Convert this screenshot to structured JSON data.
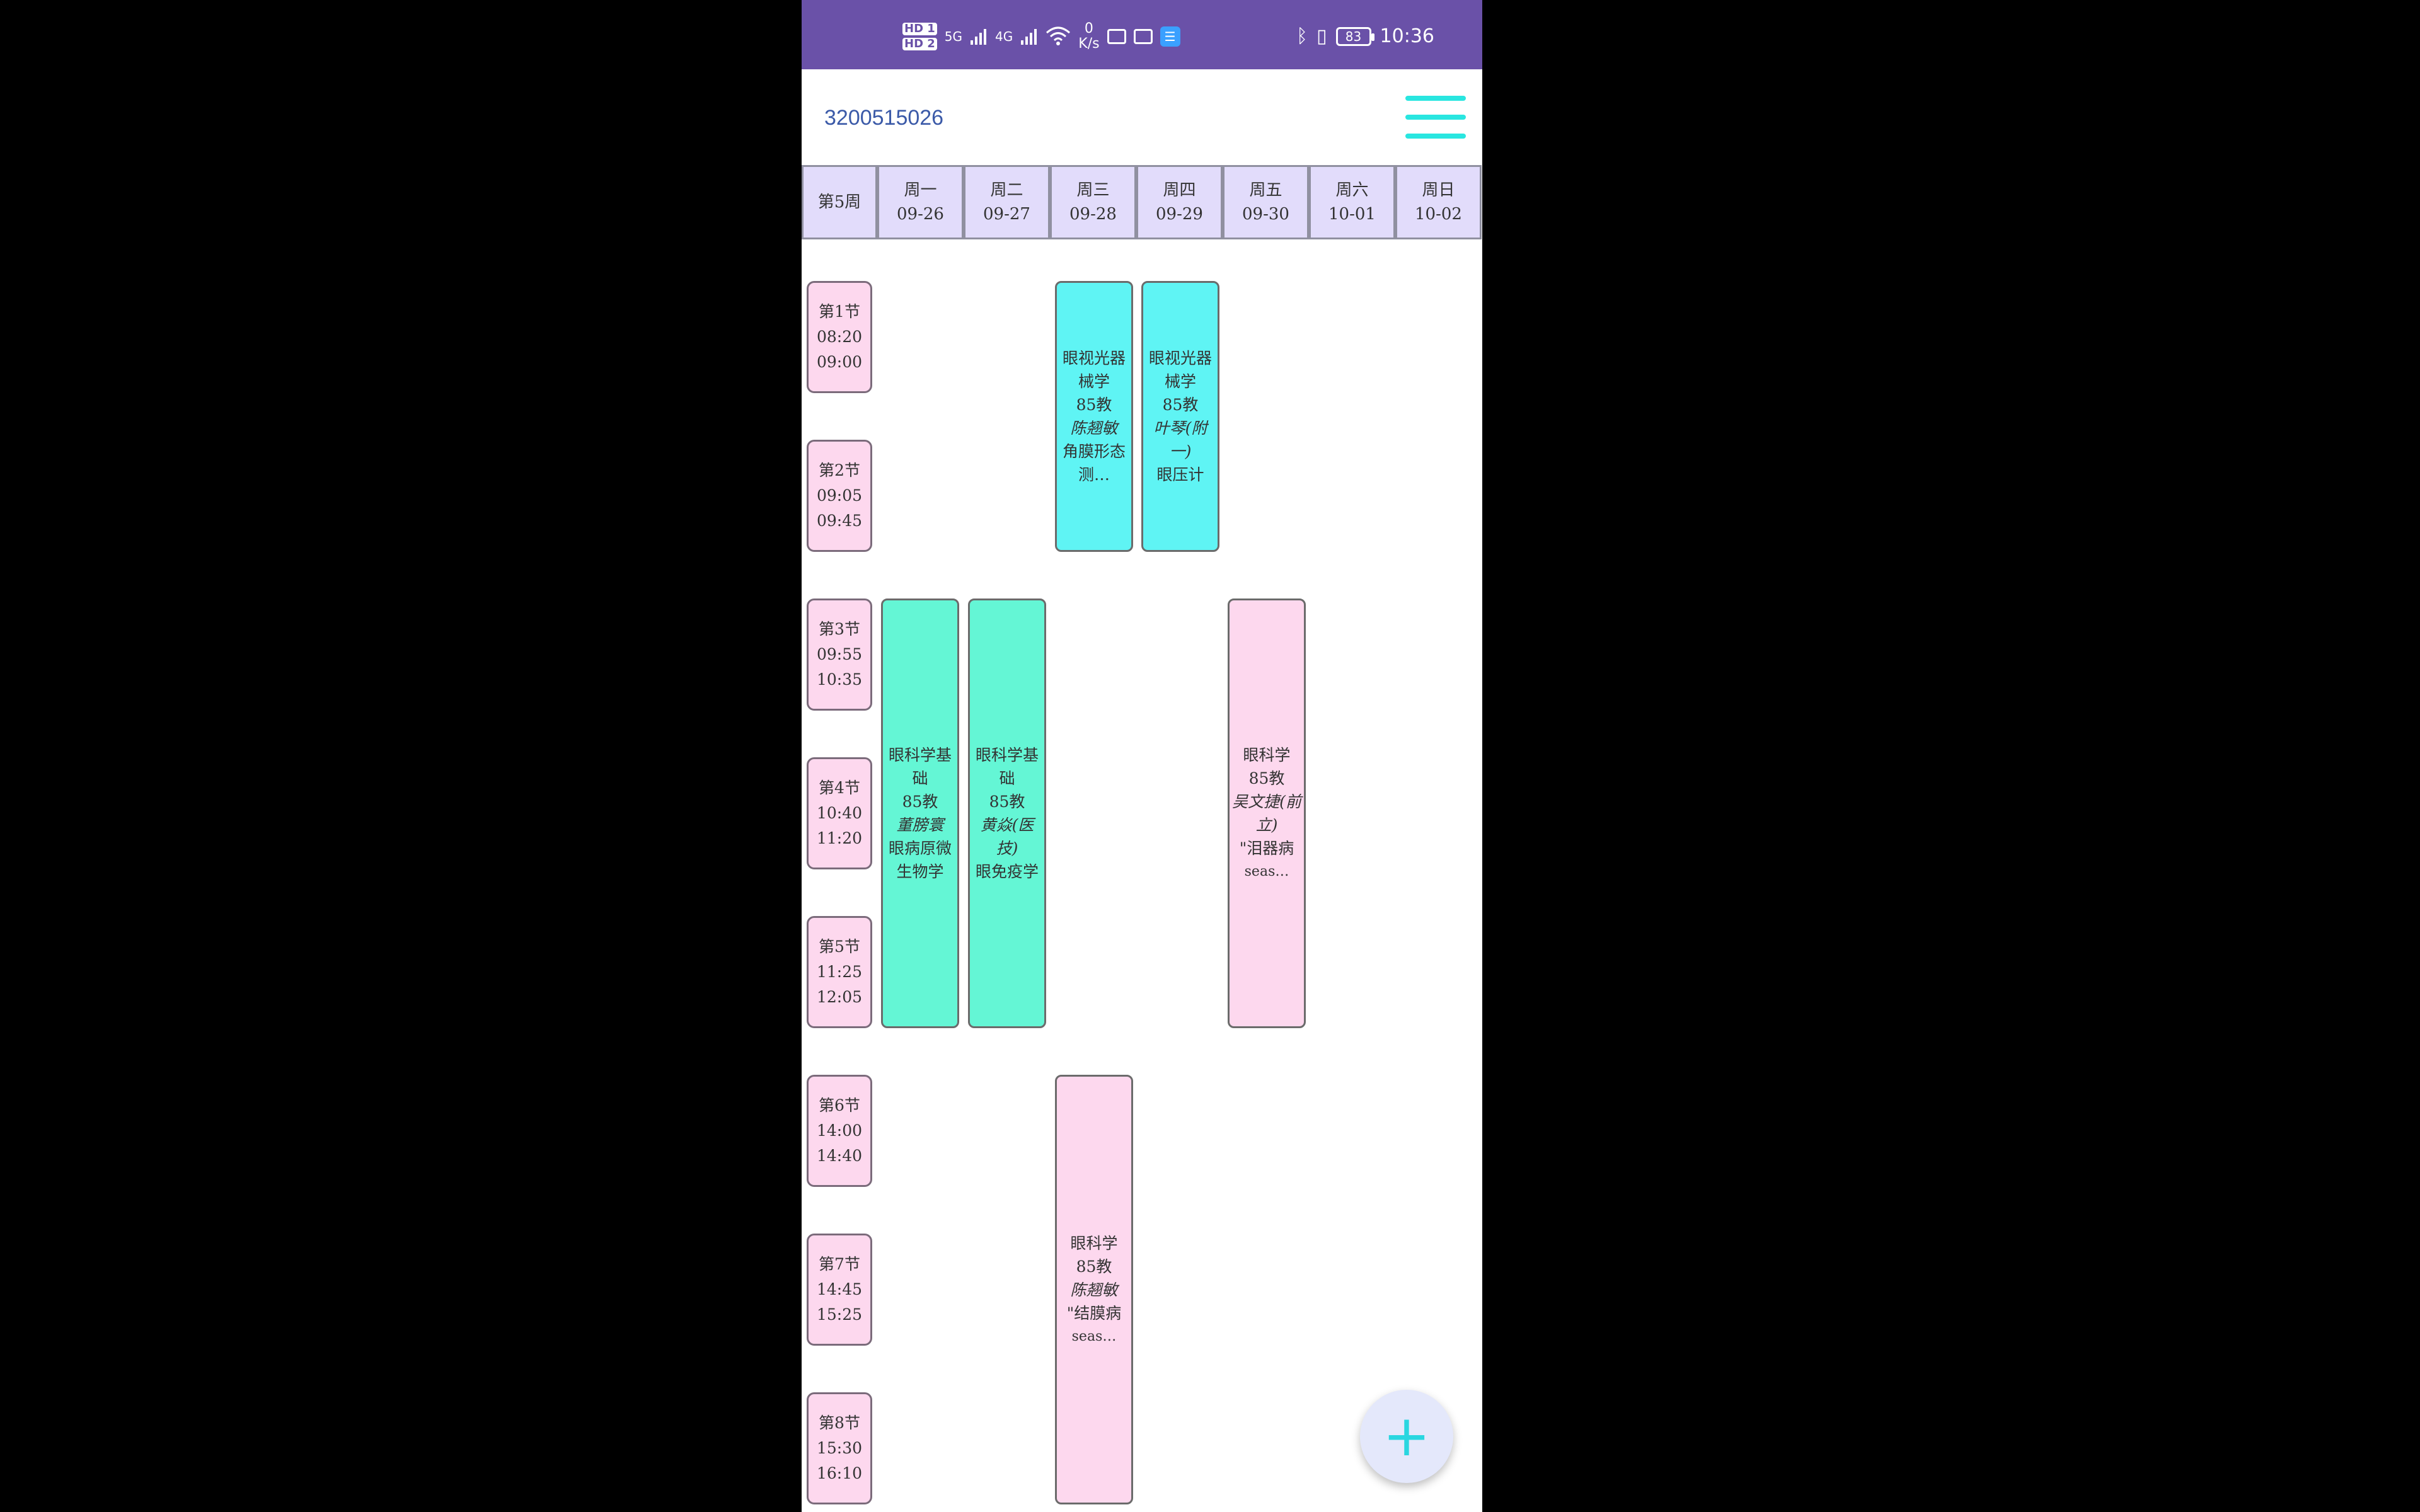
{
  "status_bar": {
    "hd1": "HD 1",
    "hd2": "HD 2",
    "sig1": "5G",
    "sig2": "4G",
    "net_speed": "0",
    "net_unit": "K/s",
    "battery": "83",
    "time": "10:36"
  },
  "header": {
    "student_id": "3200515026",
    "menu_icon": "hamburger-menu-icon"
  },
  "week_label": "第5周",
  "days": [
    {
      "name": "周一",
      "date": "09-26"
    },
    {
      "name": "周二",
      "date": "09-27"
    },
    {
      "name": "周三",
      "date": "09-28"
    },
    {
      "name": "周四",
      "date": "09-29"
    },
    {
      "name": "周五",
      "date": "09-30"
    },
    {
      "name": "周六",
      "date": "10-01"
    },
    {
      "name": "周日",
      "date": "10-02"
    }
  ],
  "periods": [
    {
      "label": "第1节",
      "start": "08:20",
      "end": "09:00"
    },
    {
      "label": "第2节",
      "start": "09:05",
      "end": "09:45"
    },
    {
      "label": "第3节",
      "start": "09:55",
      "end": "10:35"
    },
    {
      "label": "第4节",
      "start": "10:40",
      "end": "11:20"
    },
    {
      "label": "第5节",
      "start": "11:25",
      "end": "12:05"
    },
    {
      "label": "第6节",
      "start": "14:00",
      "end": "14:40"
    },
    {
      "label": "第7节",
      "start": "14:45",
      "end": "15:25"
    },
    {
      "label": "第8节",
      "start": "15:30",
      "end": "16:10"
    }
  ],
  "courses": [
    {
      "day": "周三",
      "periods": "1-2",
      "name": "眼视光器械学",
      "room": "85教",
      "teacher": "陈翘敏",
      "note": "角膜形态测…",
      "color": "#5ff4f4"
    },
    {
      "day": "周四",
      "periods": "1-2",
      "name": "眼视光器械学",
      "room": "85教",
      "teacher": "叶琴(附一)",
      "note": "眼压计",
      "color": "#5ff4f4"
    },
    {
      "day": "周一",
      "periods": "3-5",
      "name": "眼科学基础",
      "room": "85教",
      "teacher": "董膀寰",
      "note": "眼病原微生物学",
      "color": "#64f6d5"
    },
    {
      "day": "周二",
      "periods": "3-5",
      "name": "眼科学基础",
      "room": "85教",
      "teacher": "黄焱(医技)",
      "note": "眼免疫学",
      "color": "#64f6d5"
    },
    {
      "day": "周五",
      "periods": "3-5",
      "name": "眼科学",
      "room": "85教",
      "teacher": "吴文捷(前立)",
      "note": "\"泪器病",
      "extra": "seas…",
      "color": "#fdd8ee"
    },
    {
      "day": "周三",
      "periods": "6-8",
      "name": "眼科学",
      "room": "85教",
      "teacher": "陈翘敏",
      "note": "\"结膜病",
      "extra": "seas…",
      "color": "#fdd8ee"
    }
  ],
  "fab": {
    "label": "+",
    "icon": "add-icon"
  }
}
